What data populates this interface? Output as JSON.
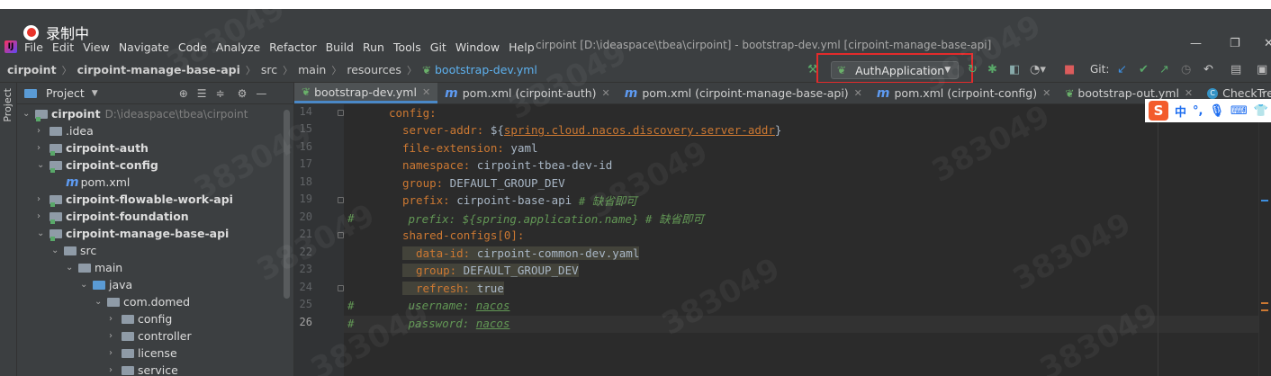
{
  "recording": {
    "label": "录制中"
  },
  "menu": {
    "items": [
      "File",
      "Edit",
      "View",
      "Navigate",
      "Code",
      "Analyze",
      "Refactor",
      "Build",
      "Run",
      "Tools",
      "Git",
      "Window",
      "Help"
    ],
    "title": "cirpoint [D:\\ideaspace\\tbea\\cirpoint] - bootstrap-dev.yml [cirpoint-manage-base-api]"
  },
  "breadcrumb": {
    "items": [
      "cirpoint",
      "cirpoint-manage-base-api",
      "src",
      "main",
      "resources"
    ],
    "file": "bootstrap-dev.yml"
  },
  "toolbar": {
    "run_config": "AuthApplication",
    "git_label": "Git:"
  },
  "project_panel": {
    "title": "Project",
    "side_label": "Project",
    "tree": [
      {
        "label": "cirpoint",
        "path": "D:\\ideaspace\\tbea\\cirpoint"
      },
      {
        "label": ".idea"
      },
      {
        "label": "cirpoint-auth"
      },
      {
        "label": "cirpoint-config"
      },
      {
        "label": "pom.xml"
      },
      {
        "label": "cirpoint-flowable-work-api"
      },
      {
        "label": "cirpoint-foundation"
      },
      {
        "label": "cirpoint-manage-base-api"
      },
      {
        "label": "src"
      },
      {
        "label": "main"
      },
      {
        "label": "java"
      },
      {
        "label": "com.domed"
      },
      {
        "label": "config"
      },
      {
        "label": "controller"
      },
      {
        "label": "license"
      },
      {
        "label": "service"
      }
    ]
  },
  "tabs": [
    {
      "label": "bootstrap-dev.yml"
    },
    {
      "label": "pom.xml (cirpoint-auth)"
    },
    {
      "label": "pom.xml (cirpoint-manage-base-api)"
    },
    {
      "label": "pom.xml (cirpoint-config)"
    },
    {
      "label": "bootstrap-out.yml"
    },
    {
      "label": "CheckTreeServiceImpl.j"
    }
  ],
  "ime": {
    "logo": "S",
    "mode": "中",
    "punct": "°,",
    "mic": "🎙",
    "kbd": "⌨",
    "skin": "👕"
  },
  "editor": {
    "line_numbers": [
      "14",
      "15",
      "16",
      "17",
      "18",
      "19",
      "20",
      "21",
      "22",
      "23",
      "24",
      "25",
      "26"
    ],
    "lines": {
      "l14": {
        "key": "config:"
      },
      "l15": {
        "key": "server-addr:",
        "pre": " ${",
        "link": "spring.cloud.nacos.discovery.server-addr",
        "post": "}"
      },
      "l16": {
        "key": "file-extension:",
        "val": " yaml"
      },
      "l17": {
        "key": "namespace:",
        "val": " cirpoint-tbea-dev-id"
      },
      "l18": {
        "key": "group:",
        "val": " DEFAULT_GROUP_DEV"
      },
      "l19": {
        "key": "prefix:",
        "val": " cirpoint-base-api ",
        "comment": "# 缺省即可"
      },
      "l20": {
        "hash": "#",
        "text": "prefix: ${spring.application.name} # 缺省即可"
      },
      "l21": {
        "key": "shared-configs[0]:"
      },
      "l22": {
        "key": "data-id:",
        "val": " cirpoint-common-dev.yaml"
      },
      "l23": {
        "key": "group:",
        "val": " DEFAULT_GROUP_DEV"
      },
      "l24": {
        "key": "refresh:",
        "val": " true"
      },
      "l25": {
        "hash": "#",
        "text": "username: ",
        "under": "nacos"
      },
      "l26": {
        "hash": "#",
        "text": "password: ",
        "under": "nacos"
      }
    }
  },
  "watermark": "383049",
  "colors": {
    "accent": "#4a88c7",
    "keyword": "#cc7832",
    "comment": "#629755",
    "highlight_box": "#e32b2b"
  }
}
